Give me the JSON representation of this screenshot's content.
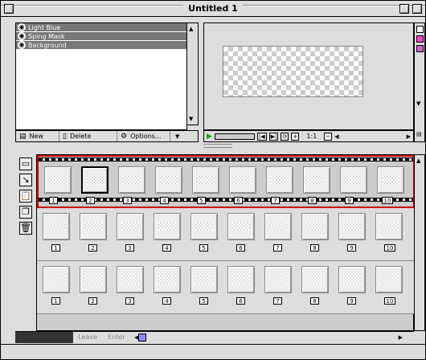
{
  "window": {
    "title": "Untitled 1"
  },
  "layers": {
    "items": [
      {
        "name": "Light Blue"
      },
      {
        "name": "Sping Mask"
      },
      {
        "name": "Background"
      }
    ],
    "new_label": "New",
    "delete_label": "Delete",
    "options_label": "Options..."
  },
  "preview": {
    "zoom": "1:1",
    "buttons": [
      "|◀",
      "▶|",
      "⟳",
      "+"
    ]
  },
  "timeline": {
    "frames": [
      "1",
      "2",
      "3",
      "4",
      "5",
      "6",
      "7",
      "8",
      "9",
      "10"
    ],
    "leave_label": "Leave",
    "enter_label": "Enter"
  },
  "colors": {
    "active_track": "#cc0000",
    "layer_highlight": "#777777"
  }
}
